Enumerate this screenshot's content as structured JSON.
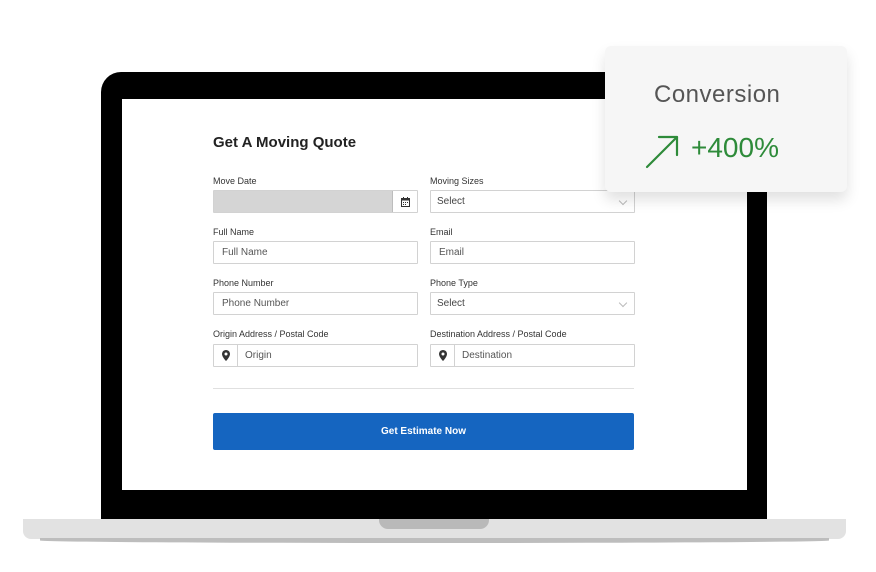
{
  "form": {
    "title": "Get A Moving Quote",
    "move_date_label": "Move Date",
    "moving_sizes_label": "Moving Sizes",
    "moving_sizes_value": "Select",
    "full_name_label": "Full Name",
    "full_name_placeholder": "Full Name",
    "email_label": "Email",
    "email_placeholder": "Email",
    "phone_number_label": "Phone Number",
    "phone_number_placeholder": "Phone Number",
    "phone_type_label": "Phone Type",
    "phone_type_value": "Select",
    "origin_label": "Origin Address / Postal Code",
    "origin_placeholder": "Origin",
    "destination_label": "Destination Address / Postal Code",
    "destination_placeholder": "Destination",
    "submit_label": "Get Estimate Now"
  },
  "stat_card": {
    "label": "Conversion",
    "value": "+400%",
    "value_color": "#2e8b3a"
  },
  "colors": {
    "accent": "#1565c0"
  },
  "icons": {
    "calendar": "calendar-icon",
    "chevron": "chevron-down-icon",
    "pin": "map-pin-icon",
    "arrow": "arrow-up-right-icon"
  }
}
